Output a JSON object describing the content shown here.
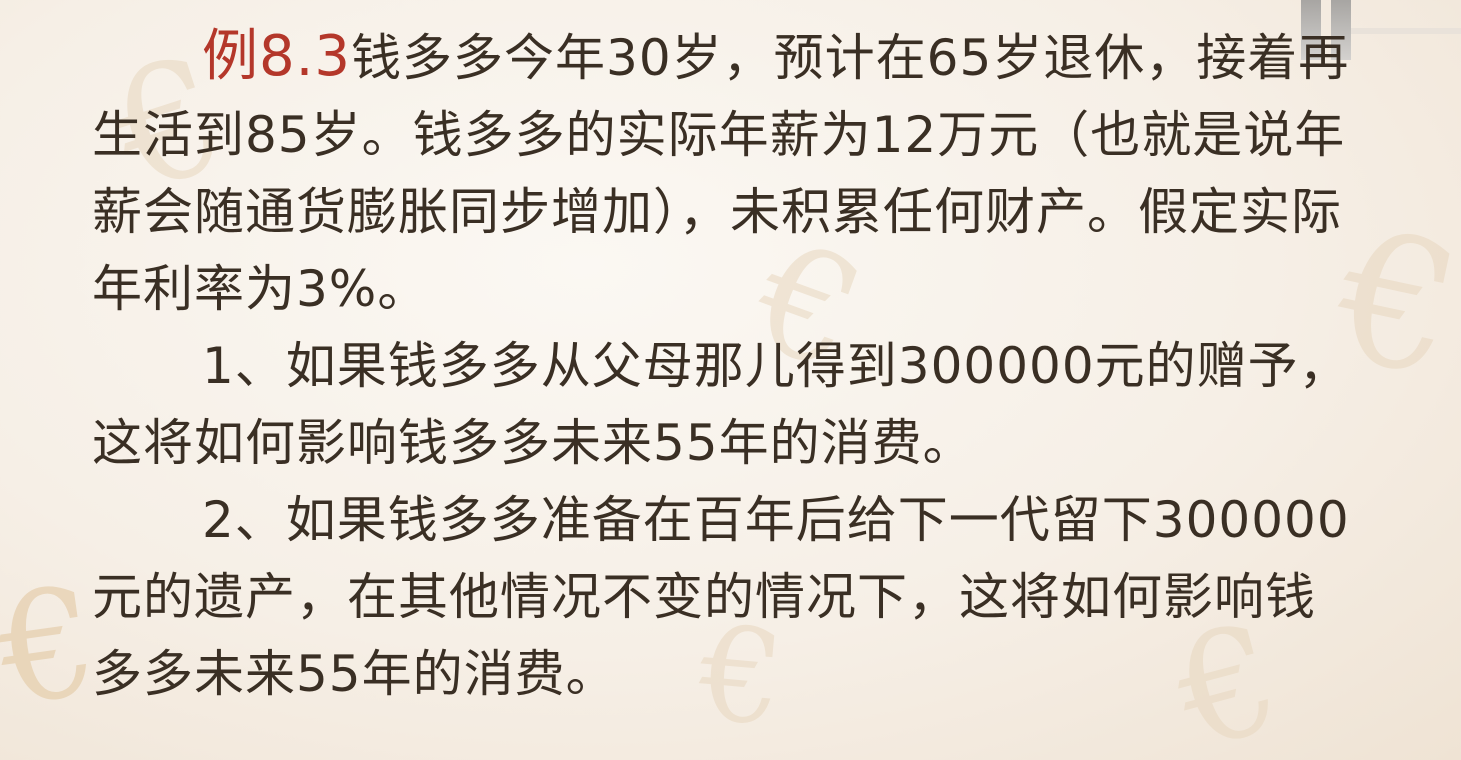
{
  "example": {
    "title": "例8.3",
    "intro": "钱多多今年30岁，预计在65岁退休，接着再生活到85岁。钱多多的实际年薪为12万元（也就是说年薪会随通货膨胀同步增加），未积累任何财产。假定实际年利率为3%。"
  },
  "questions": [
    "1、如果钱多多从父母那儿得到300000元的赠予，这将如何影响钱多多未来55年的消费。",
    "2、如果钱多多准备在百年后给下一代留下300000元的遗产，在其他情况不变的情况下，这将如何影响钱多多未来55年的消费。"
  ],
  "colors": {
    "title": "#b4372a",
    "body_text": "#3a2f24",
    "background": "#f6efe6"
  }
}
